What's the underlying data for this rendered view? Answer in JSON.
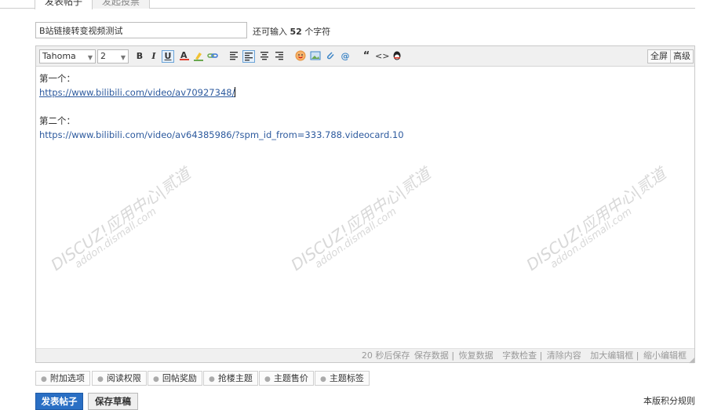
{
  "tabs": {
    "active": "发表帖子",
    "inactive": "发起投票"
  },
  "title": {
    "value": "B站链接转变视频测试",
    "hint_prefix": "还可输入",
    "remaining": "52",
    "hint_suffix": "个字符"
  },
  "toolbar": {
    "font": "Tahoma",
    "size": "2",
    "bold": "B",
    "italic": "I",
    "underline": "U",
    "quote": "“",
    "code": "<>",
    "fullscreen": "全屏",
    "advanced": "高级",
    "icons": [
      "font-color-icon",
      "highlight-icon",
      "link-icon",
      "align-left-icon",
      "align-left-active-icon",
      "align-center-icon",
      "align-right-icon",
      "emoji-icon",
      "image-icon",
      "attachment-icon",
      "at-mention-icon",
      "quote-icon",
      "code-icon",
      "qq-icon"
    ]
  },
  "content": {
    "label1": "第一个：",
    "link1": "https://www.bilibili.com/video/av70927348/",
    "label2": "第二个：",
    "link2": "https://www.bilibili.com/video/av64385986/?spm_id_from=333.788.videocard.10"
  },
  "watermark": {
    "brand": "DISCUZ!应用中心|贰道",
    "url": "addon.dismall.com"
  },
  "statusbar": {
    "autosave": "20 秒后保存",
    "save": "保存数据",
    "restore": "恢复数据",
    "wordcheck": "字数检查",
    "clear": "清除内容",
    "enlarge": "加大编辑框",
    "shrink": "缩小编辑框"
  },
  "options": [
    "附加选项",
    "阅读权限",
    "回帖奖励",
    "抢楼主题",
    "主题售价",
    "主题标签"
  ],
  "buttons": {
    "submit": "发表帖子",
    "draft": "保存草稿"
  },
  "rules": "本版积分规则",
  "colors": {
    "primary": "#2a6fc4",
    "link": "#2d5a9e",
    "watermark": "#d8d8d8"
  }
}
